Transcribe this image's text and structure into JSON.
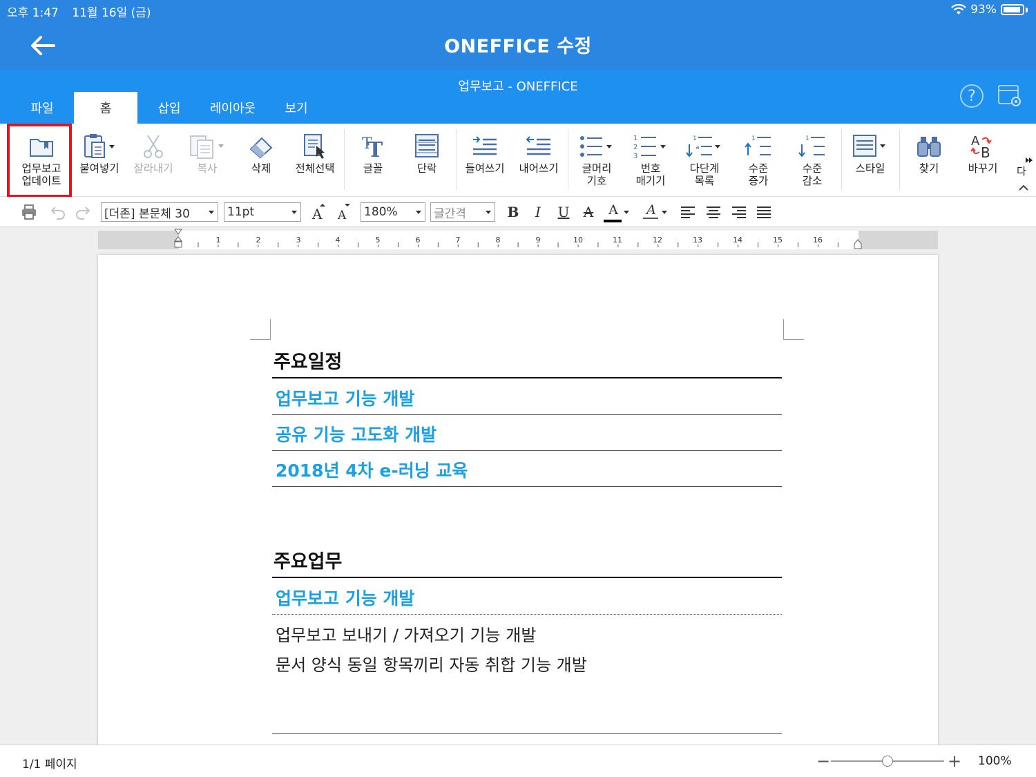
{
  "status_bar": {
    "time": "오후 1:47",
    "date": "11월 16일 (금)",
    "battery": "93%"
  },
  "app": {
    "title": "ONEFFICE 수정"
  },
  "document": {
    "title": "업무보고 - ONEFFICE"
  },
  "menu_tabs": [
    "파일",
    "홈",
    "삽입",
    "레이아웃",
    "보기"
  ],
  "ribbon": {
    "update_report": "업무보고\n업데이트",
    "paste": "붙여넣기",
    "cut": "잘라내기",
    "copy": "복사",
    "delete": "삭제",
    "select_all": "전체선택",
    "font": "글꼴",
    "paragraph": "단락",
    "indent": "들여쓰기",
    "outdent": "내어쓰기",
    "bullets": "글머리\n기호",
    "numbering": "번호\n매기기",
    "multilevel": "다단계\n목록",
    "level_up": "수준\n증가",
    "level_down": "수준\n감소",
    "style": "스타일",
    "find": "찾기",
    "replace": "바꾸기",
    "overflow_partial": "다"
  },
  "format_bar": {
    "font_name": "[더존] 본문체 30",
    "font_size": "11pt",
    "line_spacing": "180%",
    "char_spacing": "글간격",
    "bold": "B",
    "italic": "I",
    "underline": "U",
    "strike": "A",
    "font_color": "A",
    "highlight_color": "A"
  },
  "ruler": {
    "numbers": [
      "1",
      "2",
      "3",
      "4",
      "5",
      "6",
      "7",
      "8",
      "9",
      "10",
      "11",
      "12",
      "13",
      "14",
      "15",
      "16"
    ]
  },
  "content": {
    "section1_title": "주요일정",
    "section1_items": [
      "업무보고 기능 개발",
      "공유 기능 고도화 개발",
      "2018년 4차 e-러닝 교육"
    ],
    "section2_title": "주요업무",
    "section2_item": "업무보고 기능 개발",
    "section2_lines": [
      "업무보고 보내기 / 가져오기 기능 개발",
      "문서 양식 동일 항목끼리 자동 취합 기능 개발"
    ]
  },
  "footer": {
    "page_count": "1/1 페이지",
    "zoom": "100%"
  },
  "colors": {
    "app_bar": "#2a86e0",
    "tab_band": "#1e90f0",
    "item_blue": "#1ba1e2",
    "highlight": "#e8121b"
  }
}
